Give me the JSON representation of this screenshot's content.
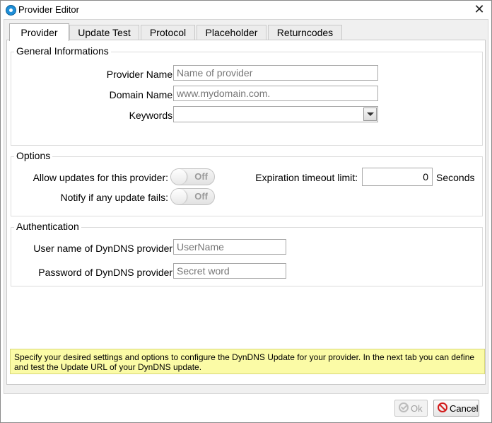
{
  "window": {
    "title": "Provider Editor",
    "close_glyph": "✕",
    "app_icon": "app-icon"
  },
  "tabs": [
    {
      "label": "Provider",
      "active": true
    },
    {
      "label": "Update Test",
      "active": false
    },
    {
      "label": "Protocol",
      "active": false
    },
    {
      "label": "Placeholder",
      "active": false
    },
    {
      "label": "Returncodes",
      "active": false
    }
  ],
  "general": {
    "title": "General Informations",
    "provider_name_label": "Provider Name:",
    "provider_name_placeholder": "Name of provider",
    "domain_name_label": "Domain Name:",
    "domain_name_placeholder": "www.mydomain.com.",
    "keywords_label": "Keywords:",
    "keywords_value": ""
  },
  "options": {
    "title": "Options",
    "allow_updates_label": "Allow updates for this provider:",
    "allow_updates_state": "Off",
    "notify_label": "Notify if any update fails:",
    "notify_state": "Off",
    "expiration_label": "Expiration timeout limit:",
    "expiration_value": "0",
    "expiration_unit": "Seconds"
  },
  "auth": {
    "title": "Authentication",
    "username_label": "User name of DynDNS provider:",
    "username_placeholder": "UserName",
    "password_label": "Password of DynDNS provider:",
    "password_placeholder": "Secret word"
  },
  "hint": "Specify your desired settings and options to configure the DynDNS Update for your provider. In the next tab you can define and test the Update URL of your DynDNS update.",
  "buttons": {
    "ok": "Ok",
    "cancel": "Cancel"
  },
  "colors": {
    "hint_background": "#fbfba6",
    "cancel_icon": "#d21a1a"
  }
}
